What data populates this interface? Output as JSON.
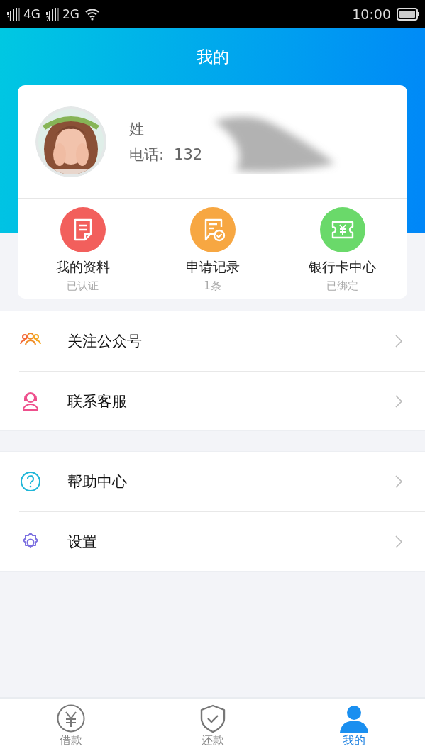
{
  "status_bar": {
    "sims": [
      {
        "slot": "1",
        "network": "4G"
      },
      {
        "slot": "2",
        "network": "2G"
      }
    ],
    "time": "10:00"
  },
  "header": {
    "title": "我的"
  },
  "profile": {
    "name_label": "姓",
    "phone_label": "电话:",
    "phone_value": "132"
  },
  "shortcuts": [
    {
      "kind": "profile",
      "label": "我的资料",
      "sub": "已认证",
      "color": "#f25f5c"
    },
    {
      "kind": "records",
      "label": "申请记录",
      "sub": "1条",
      "color": "#f7a742"
    },
    {
      "kind": "bankcard",
      "label": "银行卡中心",
      "sub": "已绑定",
      "color": "#6ad96a"
    }
  ],
  "menu_groups": [
    [
      {
        "kind": "follow",
        "label": "关注公众号"
      },
      {
        "kind": "service",
        "label": "联系客服"
      }
    ],
    [
      {
        "kind": "help",
        "label": "帮助中心"
      },
      {
        "kind": "settings",
        "label": "设置"
      }
    ]
  ],
  "tabs": [
    {
      "kind": "loan",
      "label": "借款",
      "selected": false
    },
    {
      "kind": "repay",
      "label": "还款",
      "selected": false
    },
    {
      "kind": "mine",
      "label": "我的",
      "selected": true
    }
  ]
}
